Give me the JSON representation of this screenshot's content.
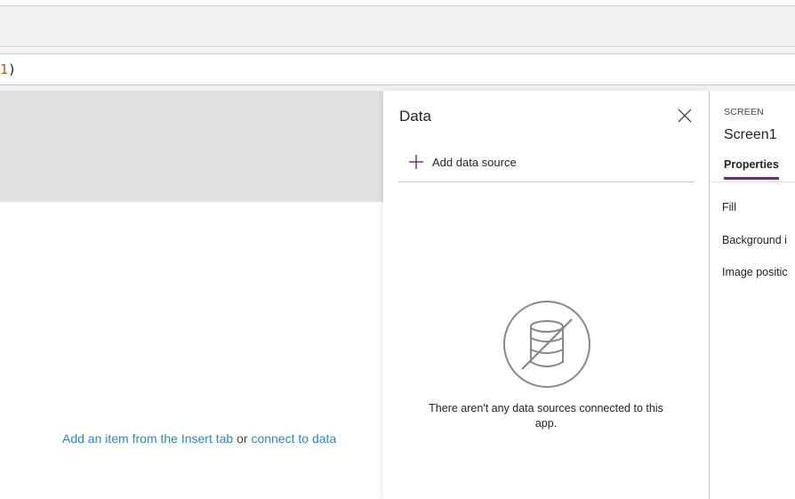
{
  "formula_bar": {
    "prefix": "",
    "number": "1",
    "suffix": ")"
  },
  "canvas": {
    "hint_link1": "Add an item from the Insert tab",
    "hint_sep": "or",
    "hint_link2": "connect to data"
  },
  "data_panel": {
    "title": "Data",
    "add_source_label": "Add data source",
    "empty_message": "There aren't any data sources connected to this app."
  },
  "properties": {
    "kind": "SCREEN",
    "name": "Screen1",
    "tab_label": "Properties",
    "rows": [
      "Fill",
      "Background i",
      "Image positic"
    ]
  },
  "colors": {
    "accent": "#742774",
    "link": "#2e86c1",
    "canvas_header": "#e1e1e1"
  }
}
